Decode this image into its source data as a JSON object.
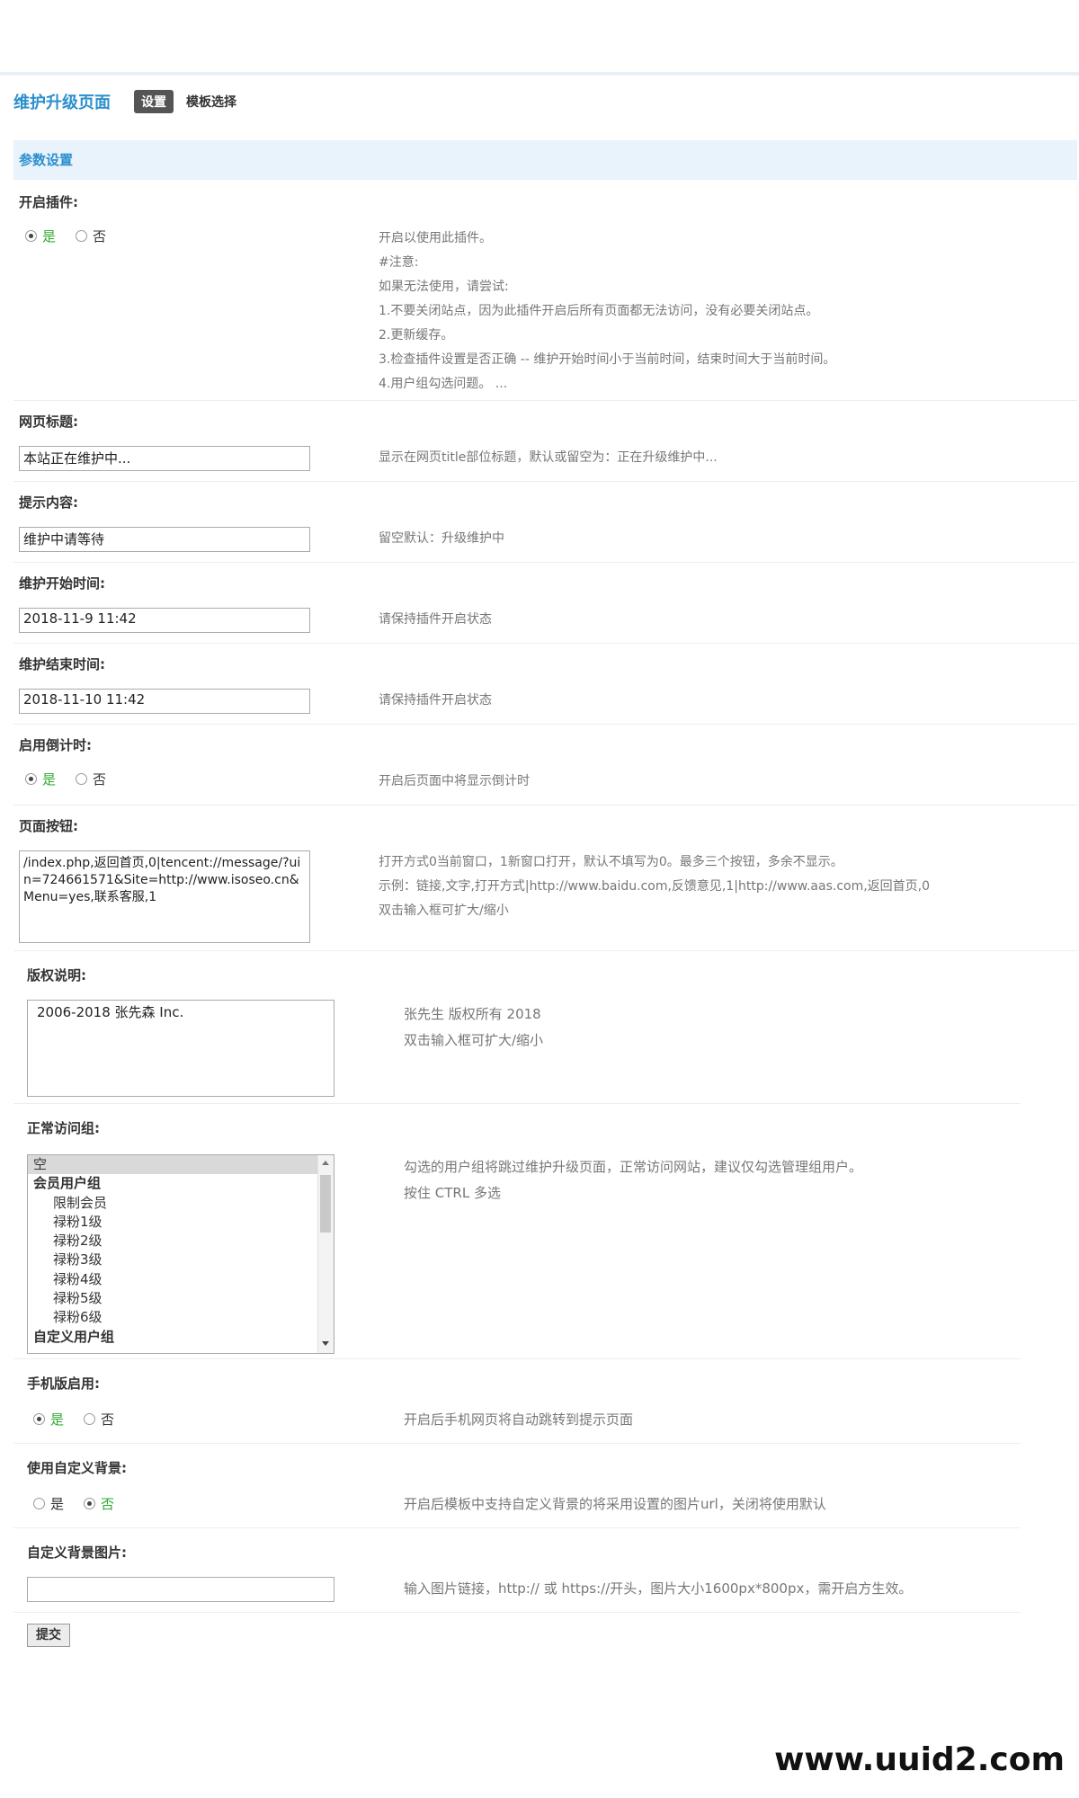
{
  "header": {
    "title": "维护升级页面",
    "tab_active": "设置",
    "tab_other": "模板选择"
  },
  "section": {
    "title": "参数设置"
  },
  "fields": {
    "enable_plugin": {
      "label": "开启插件:",
      "yes": "是",
      "no": "否",
      "selected": "是",
      "hints": [
        "开启以使用此插件。",
        "#注意:",
        "如果无法使用，请尝试:",
        "1.不要关闭站点，因为此插件开启后所有页面都无法访问，没有必要关闭站点。",
        "2.更新缓存。",
        "3.检查插件设置是否正确 -- 维护开始时间小于当前时间，结束时间大于当前时间。",
        "4.用户组勾选问题。 ..."
      ]
    },
    "page_title": {
      "label": "网页标题:",
      "value": "本站正在维护中...",
      "hint": "显示在网页title部位标题，默认或留空为：正在升级维护中..."
    },
    "tip_content": {
      "label": "提示内容:",
      "value": "维护中请等待",
      "hint": "留空默认：升级维护中"
    },
    "start_time": {
      "label": "维护开始时间:",
      "value": "2018-11-9 11:42",
      "hint": "请保持插件开启状态"
    },
    "end_time": {
      "label": "维护结束时间:",
      "value": "2018-11-10 11:42",
      "hint": "请保持插件开启状态"
    },
    "countdown": {
      "label": "启用倒计时:",
      "yes": "是",
      "no": "否",
      "selected": "是",
      "hint": "开启后页面中将显示倒计时"
    },
    "page_buttons": {
      "label": "页面按钮:",
      "value": "/index.php,返回首页,0|tencent://message/?uin=724661571&Site=http://www.isoseo.cn&Menu=yes,联系客服,1",
      "hints": [
        "打开方式0当前窗口，1新窗口打开，默认不填写为0。最多三个按钮，多余不显示。",
        "示例：链接,文字,打开方式|http://www.baidu.com,反馈意见,1|http://www.aas.com,返回首页,0",
        "双击输入框可扩大/缩小"
      ]
    },
    "copyright": {
      "label": "版权说明:",
      "value": "2006-2018 张先森 Inc.",
      "hints": [
        "张先生 版权所有 2018",
        "双击输入框可扩大/缩小"
      ]
    },
    "normal_groups": {
      "label": "正常访问组:",
      "options": [
        {
          "text": "空",
          "kind": "sel"
        },
        {
          "text": "会员用户组",
          "kind": "group"
        },
        {
          "text": "限制会员",
          "kind": "child"
        },
        {
          "text": "禄粉1级",
          "kind": "child"
        },
        {
          "text": "禄粉2级",
          "kind": "child"
        },
        {
          "text": "禄粉3级",
          "kind": "child"
        },
        {
          "text": "禄粉4级",
          "kind": "child"
        },
        {
          "text": "禄粉5级",
          "kind": "child"
        },
        {
          "text": "禄粉6级",
          "kind": "child"
        },
        {
          "text": "自定义用户组",
          "kind": "group"
        }
      ],
      "hints": [
        "勾选的用户组将跳过维护升级页面，正常访问网站，建议仅勾选管理组用户。",
        "按住 CTRL 多选"
      ]
    },
    "mobile": {
      "label": "手机版启用:",
      "yes": "是",
      "no": "否",
      "selected": "是",
      "hint": "开启后手机网页将自动跳转到提示页面"
    },
    "custom_bg": {
      "label": "使用自定义背景:",
      "yes": "是",
      "no": "否",
      "selected": "否",
      "hint": "开启后模板中支持自定义背景的将采用设置的图片url，关闭将使用默认"
    },
    "bg_image": {
      "label": "自定义背景图片:",
      "value": "",
      "hint": "输入图片链接，http:// 或 https://开头，图片大小1600px*800px，需开启方生效。"
    }
  },
  "submit_label": "提交",
  "watermark": "www.uuid2.com",
  "colors": {
    "accent": "#2b8fce",
    "section_bg": "#e9f3fb",
    "green": "#2eab2e",
    "hint": "#777777"
  }
}
